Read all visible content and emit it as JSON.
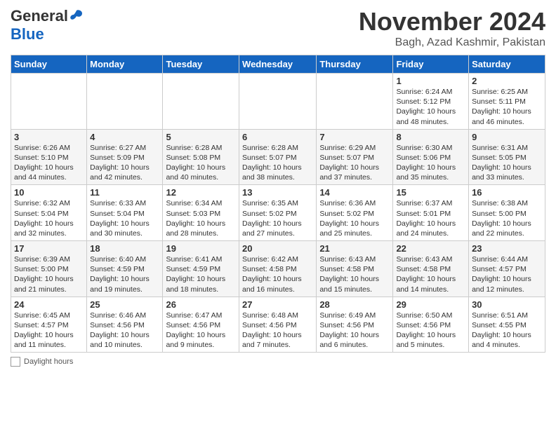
{
  "header": {
    "logo_general": "General",
    "logo_blue": "Blue",
    "month_title": "November 2024",
    "location": "Bagh, Azad Kashmir, Pakistan"
  },
  "days_of_week": [
    "Sunday",
    "Monday",
    "Tuesday",
    "Wednesday",
    "Thursday",
    "Friday",
    "Saturday"
  ],
  "weeks": [
    [
      {
        "num": "",
        "info": ""
      },
      {
        "num": "",
        "info": ""
      },
      {
        "num": "",
        "info": ""
      },
      {
        "num": "",
        "info": ""
      },
      {
        "num": "",
        "info": ""
      },
      {
        "num": "1",
        "info": "Sunrise: 6:24 AM\nSunset: 5:12 PM\nDaylight: 10 hours and 48 minutes."
      },
      {
        "num": "2",
        "info": "Sunrise: 6:25 AM\nSunset: 5:11 PM\nDaylight: 10 hours and 46 minutes."
      }
    ],
    [
      {
        "num": "3",
        "info": "Sunrise: 6:26 AM\nSunset: 5:10 PM\nDaylight: 10 hours and 44 minutes."
      },
      {
        "num": "4",
        "info": "Sunrise: 6:27 AM\nSunset: 5:09 PM\nDaylight: 10 hours and 42 minutes."
      },
      {
        "num": "5",
        "info": "Sunrise: 6:28 AM\nSunset: 5:08 PM\nDaylight: 10 hours and 40 minutes."
      },
      {
        "num": "6",
        "info": "Sunrise: 6:28 AM\nSunset: 5:07 PM\nDaylight: 10 hours and 38 minutes."
      },
      {
        "num": "7",
        "info": "Sunrise: 6:29 AM\nSunset: 5:07 PM\nDaylight: 10 hours and 37 minutes."
      },
      {
        "num": "8",
        "info": "Sunrise: 6:30 AM\nSunset: 5:06 PM\nDaylight: 10 hours and 35 minutes."
      },
      {
        "num": "9",
        "info": "Sunrise: 6:31 AM\nSunset: 5:05 PM\nDaylight: 10 hours and 33 minutes."
      }
    ],
    [
      {
        "num": "10",
        "info": "Sunrise: 6:32 AM\nSunset: 5:04 PM\nDaylight: 10 hours and 32 minutes."
      },
      {
        "num": "11",
        "info": "Sunrise: 6:33 AM\nSunset: 5:04 PM\nDaylight: 10 hours and 30 minutes."
      },
      {
        "num": "12",
        "info": "Sunrise: 6:34 AM\nSunset: 5:03 PM\nDaylight: 10 hours and 28 minutes."
      },
      {
        "num": "13",
        "info": "Sunrise: 6:35 AM\nSunset: 5:02 PM\nDaylight: 10 hours and 27 minutes."
      },
      {
        "num": "14",
        "info": "Sunrise: 6:36 AM\nSunset: 5:02 PM\nDaylight: 10 hours and 25 minutes."
      },
      {
        "num": "15",
        "info": "Sunrise: 6:37 AM\nSunset: 5:01 PM\nDaylight: 10 hours and 24 minutes."
      },
      {
        "num": "16",
        "info": "Sunrise: 6:38 AM\nSunset: 5:00 PM\nDaylight: 10 hours and 22 minutes."
      }
    ],
    [
      {
        "num": "17",
        "info": "Sunrise: 6:39 AM\nSunset: 5:00 PM\nDaylight: 10 hours and 21 minutes."
      },
      {
        "num": "18",
        "info": "Sunrise: 6:40 AM\nSunset: 4:59 PM\nDaylight: 10 hours and 19 minutes."
      },
      {
        "num": "19",
        "info": "Sunrise: 6:41 AM\nSunset: 4:59 PM\nDaylight: 10 hours and 18 minutes."
      },
      {
        "num": "20",
        "info": "Sunrise: 6:42 AM\nSunset: 4:58 PM\nDaylight: 10 hours and 16 minutes."
      },
      {
        "num": "21",
        "info": "Sunrise: 6:43 AM\nSunset: 4:58 PM\nDaylight: 10 hours and 15 minutes."
      },
      {
        "num": "22",
        "info": "Sunrise: 6:43 AM\nSunset: 4:58 PM\nDaylight: 10 hours and 14 minutes."
      },
      {
        "num": "23",
        "info": "Sunrise: 6:44 AM\nSunset: 4:57 PM\nDaylight: 10 hours and 12 minutes."
      }
    ],
    [
      {
        "num": "24",
        "info": "Sunrise: 6:45 AM\nSunset: 4:57 PM\nDaylight: 10 hours and 11 minutes."
      },
      {
        "num": "25",
        "info": "Sunrise: 6:46 AM\nSunset: 4:56 PM\nDaylight: 10 hours and 10 minutes."
      },
      {
        "num": "26",
        "info": "Sunrise: 6:47 AM\nSunset: 4:56 PM\nDaylight: 10 hours and 9 minutes."
      },
      {
        "num": "27",
        "info": "Sunrise: 6:48 AM\nSunset: 4:56 PM\nDaylight: 10 hours and 7 minutes."
      },
      {
        "num": "28",
        "info": "Sunrise: 6:49 AM\nSunset: 4:56 PM\nDaylight: 10 hours and 6 minutes."
      },
      {
        "num": "29",
        "info": "Sunrise: 6:50 AM\nSunset: 4:56 PM\nDaylight: 10 hours and 5 minutes."
      },
      {
        "num": "30",
        "info": "Sunrise: 6:51 AM\nSunset: 4:55 PM\nDaylight: 10 hours and 4 minutes."
      }
    ]
  ],
  "footer": {
    "daylight_label": "Daylight hours"
  }
}
